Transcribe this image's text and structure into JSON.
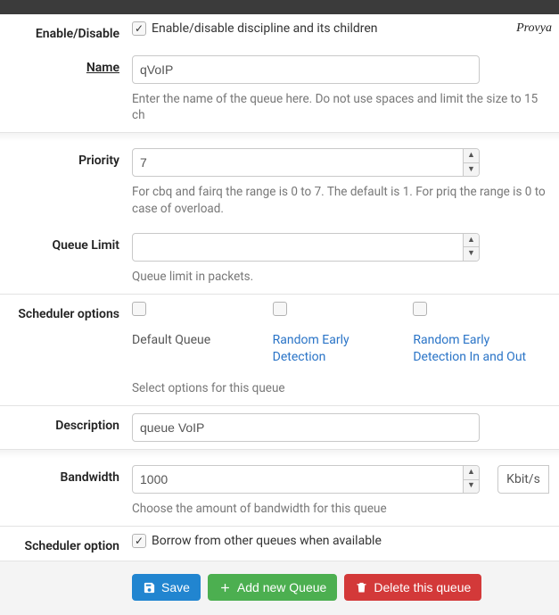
{
  "brand": "Provya",
  "fields": {
    "enable": {
      "label": "Enable/Disable",
      "checked": true,
      "text": "Enable/disable discipline and its children"
    },
    "name": {
      "label": "Name",
      "value": "qVoIP",
      "help": "Enter the name of the queue here. Do not use spaces and limit the size to 15 ch"
    },
    "priority": {
      "label": "Priority",
      "value": "7",
      "help": "For cbq and fairq the range is 0 to 7. The default is 1. For priq the range is 0 to case of overload."
    },
    "queue_limit": {
      "label": "Queue Limit",
      "value": "",
      "help": "Queue limit in packets."
    },
    "scheduler_options": {
      "label": "Scheduler options",
      "opt1": {
        "checked": false,
        "text": "Default Queue",
        "link": false
      },
      "opt2": {
        "checked": false,
        "text": "Random Early Detection",
        "link": true
      },
      "opt3": {
        "checked": false,
        "text": "Random Early Detection In and Out",
        "link": true
      },
      "help": "Select options for this queue"
    },
    "description": {
      "label": "Description",
      "value": "queue VoIP"
    },
    "bandwidth": {
      "label": "Bandwidth",
      "value": "1000",
      "unit": "Kbit/s",
      "help": "Choose the amount of bandwidth for this queue"
    },
    "scheduler_option": {
      "label": "Scheduler option",
      "checked": true,
      "text": "Borrow from other queues when available"
    }
  },
  "buttons": {
    "save": "Save",
    "add": "Add new Queue",
    "delete": "Delete this queue"
  }
}
